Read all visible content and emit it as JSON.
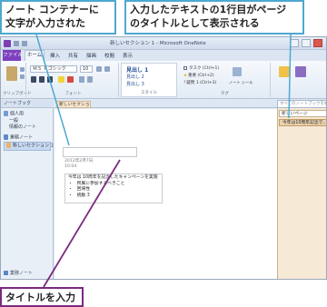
{
  "callouts": {
    "left_line1": "ノート コンテナーに",
    "left_line2": "文字が入力された",
    "right_line1": "入力したテキストの1行目がページ",
    "right_line2": "のタイトルとして表示される",
    "bottom": "タイトルを入力"
  },
  "window": {
    "title": "新しいセクション 1 - Microsoft OneNote"
  },
  "ribbon": {
    "tabs": [
      "ファイル",
      "ホーム",
      "挿入",
      "共有",
      "描画",
      "校閲",
      "表示"
    ],
    "font_name": "ＭＳ Ｐゴシック",
    "font_size": "10",
    "groups": [
      "クリップボード",
      "フォント",
      "スタイル",
      "タグ"
    ],
    "styles": [
      "見出し 1",
      "見出し 2",
      "見出し 3"
    ],
    "tags": [
      "タスク (Ctrl+1)",
      "重要 (Ctrl+2)",
      "疑問 1 (Ctrl+3)"
    ],
    "tag_note_label": "ノート シール"
  },
  "nav": {
    "header": "ノートブック",
    "notebooks": [
      "個人用",
      "一般",
      "情報のノート",
      "業務ノート",
      "新しいセクション 1"
    ],
    "footer": "業務ノート"
  },
  "section": {
    "tab_label": "新しいセクション 1"
  },
  "search": {
    "placeholder": "すべてのノートブックを検索 (Ctrl+E)"
  },
  "pages": {
    "add_label": "新しいページ",
    "items": [
      "今年は10周年記念で..."
    ]
  },
  "page": {
    "title": "",
    "date": "2012年2月7日",
    "time": "10:04",
    "lines": [
      "今年は 10周年を記念したキャンペーンを実施",
      "・　所属に参加するべきこと",
      "・　回帰性",
      "・　統動 3"
    ]
  },
  "colors": {
    "callout_border": "#4ea8d0",
    "callout_bottom_border": "#7a2a7f",
    "leader_line": "#7a2a7f",
    "file_tab": "#7f3fbf"
  }
}
